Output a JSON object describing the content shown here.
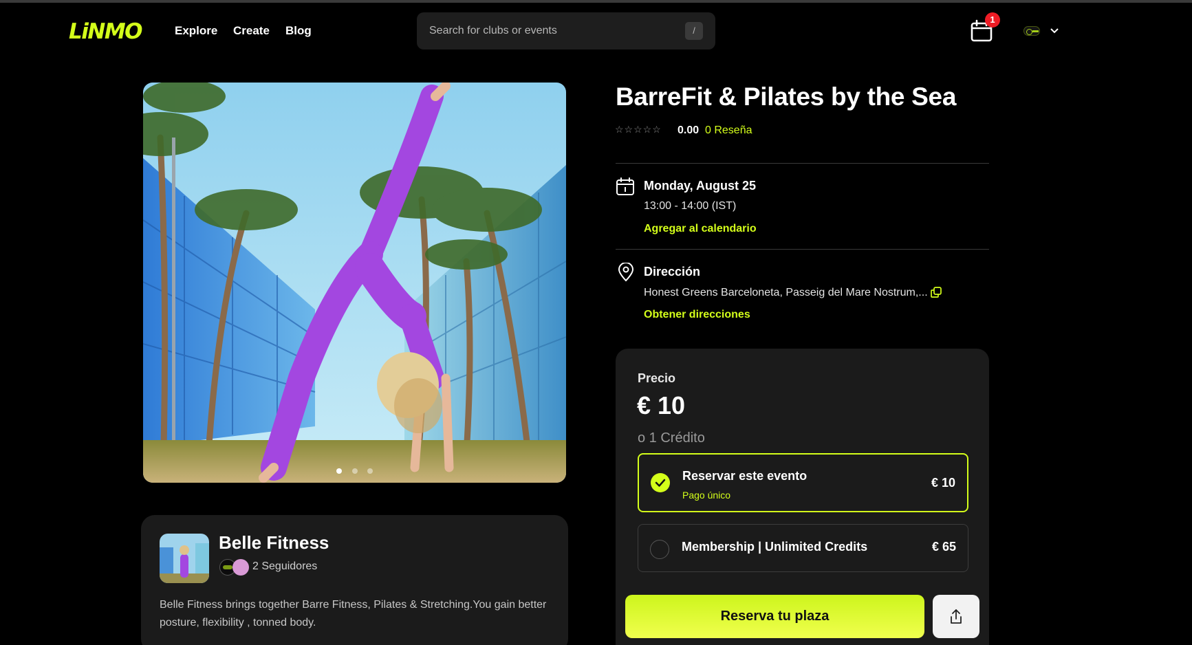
{
  "header": {
    "logo": "LiNMO",
    "nav": [
      "Explore",
      "Create",
      "Blog"
    ],
    "search_placeholder": "Search for clubs or events",
    "search_shortcut": "/",
    "cart_count": "1"
  },
  "event": {
    "title": "BarreFit & Pilates by the Sea",
    "stars": "☆☆☆☆☆",
    "rating": "0.00",
    "reviews": "0 Reseña",
    "date": "Monday, August 25",
    "time": "13:00 - 14:00 (IST)",
    "add_calendar": "Agregar al calendario",
    "address_title": "Dirección",
    "address": "Honest Greens Barceloneta, Passeig del Mare Nostrum,...",
    "directions": "Obtener direcciones"
  },
  "pricing": {
    "label": "Precio",
    "amount": "€ 10",
    "credit": "o 1 Crédito",
    "options": [
      {
        "name": "Reservar este evento",
        "sub": "Pago único",
        "price": "€ 10",
        "selected": true
      },
      {
        "name": "Membership | Unlimited Credits",
        "price": "€ 65",
        "selected": false
      }
    ],
    "cta": "Reserva tu plaza"
  },
  "club": {
    "name": "Belle Fitness",
    "followers": "2 Seguidores",
    "description": "Belle Fitness brings together Barre Fitness, Pilates & Stretching.You gain better posture, flexibility , tonned body."
  },
  "gallery": {
    "slides": 3,
    "active": 0
  },
  "colors": {
    "accent": "#d4ff1a",
    "background": "#000000",
    "card": "#1b1b1b",
    "badge": "#ee1c25"
  },
  "icons": [
    "calendar-icon",
    "location-pin-icon",
    "copy-icon",
    "check-icon",
    "share-icon",
    "chevron-down-icon"
  ]
}
